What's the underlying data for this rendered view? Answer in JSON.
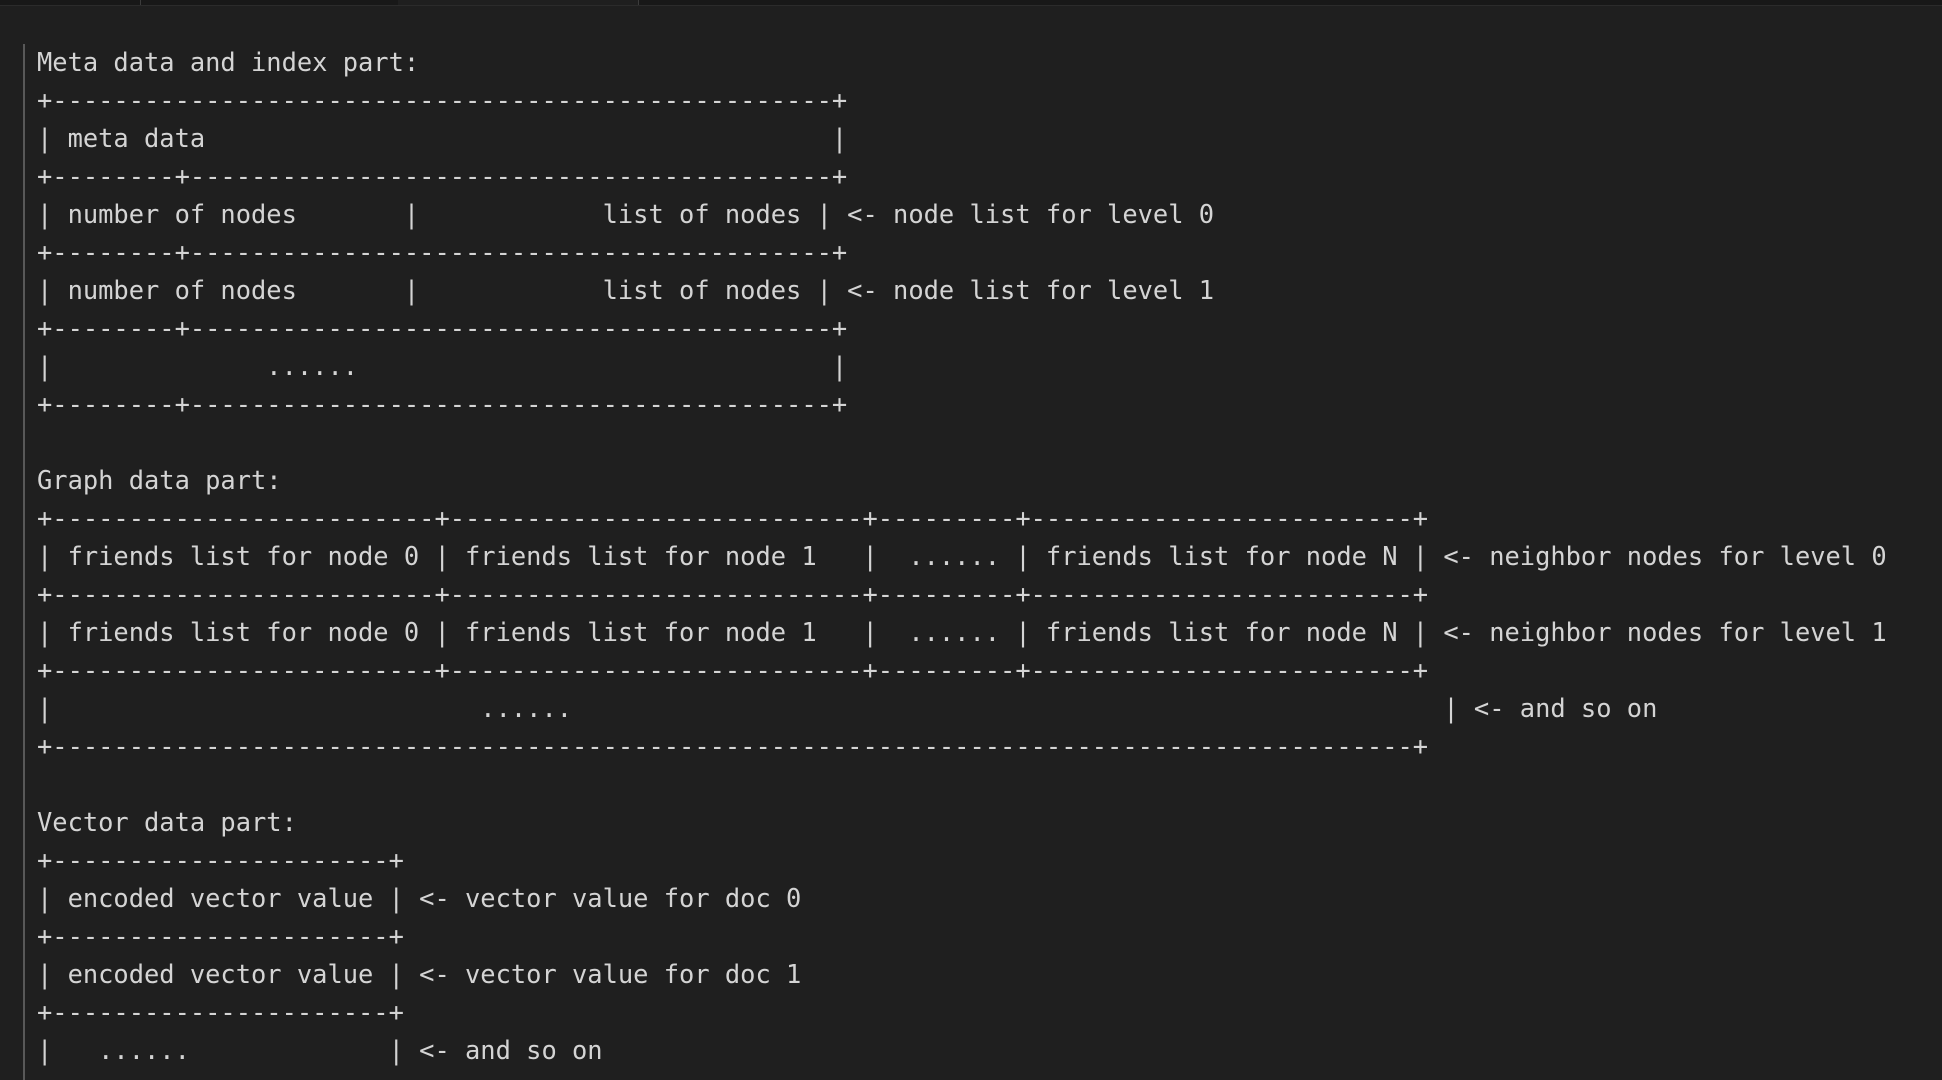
{
  "editor": {
    "lines": [
      "Meta data and index part:",
      "+---------------------------------------------------+",
      "| meta data                                         |",
      "+--------+------------------------------------------+",
      "| number of nodes       |            list of nodes | <- node list for level 0",
      "+--------+------------------------------------------+",
      "| number of nodes       |            list of nodes | <- node list for level 1",
      "+--------+------------------------------------------+",
      "|              ......                               |",
      "+--------+------------------------------------------+",
      "",
      "Graph data part:",
      "+-------------------------+---------------------------+---------+-------------------------+",
      "| friends list for node 0 | friends list for node 1   |  ...... | friends list for node N | <- neighbor nodes for level 0",
      "+-------------------------+---------------------------+---------+-------------------------+",
      "| friends list for node 0 | friends list for node 1   |  ...... | friends list for node N | <- neighbor nodes for level 1",
      "+-------------------------+---------------------------+---------+-------------------------+",
      "|                            ......                                                         | <- and so on",
      "+-----------------------------------------------------------------------------------------+",
      "",
      "Vector data part:",
      "+----------------------+",
      "| encoded vector value | <- vector value for doc 0",
      "+----------------------+",
      "| encoded vector value | <- vector value for doc 1",
      "+----------------------+",
      "|   ......             | <- and so on"
    ]
  },
  "colors": {
    "background": "#1f1f1f",
    "text": "#d4d4d4",
    "gutter": "#585858"
  }
}
